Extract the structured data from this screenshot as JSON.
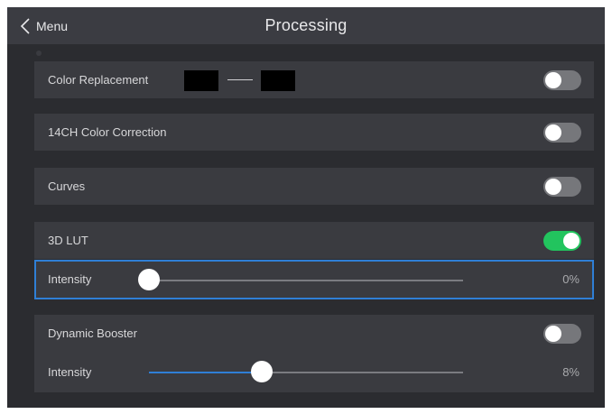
{
  "header": {
    "back_label": "Menu",
    "title": "Processing"
  },
  "rows": {
    "color_replacement": {
      "label": "Color Replacement",
      "enabled": false,
      "from_color": "#000000",
      "to_color": "#000000"
    },
    "color_correction": {
      "label": "14CH Color Correction",
      "enabled": false
    },
    "curves": {
      "label": "Curves",
      "enabled": false
    },
    "lut3d": {
      "label": "3D LUT",
      "enabled": true,
      "intensity_label": "Intensity",
      "intensity_value": "0%",
      "intensity_fraction": 0.0
    },
    "dynamic_booster": {
      "label": "Dynamic Booster",
      "enabled": false,
      "intensity_label": "Intensity",
      "intensity_value": "8%",
      "intensity_fraction": 0.36
    }
  },
  "colors": {
    "accent": "#2f7fd6",
    "toggle_on": "#22c45e",
    "toggle_off": "#76777b"
  },
  "icons": {
    "back": "chevron-left-icon"
  }
}
